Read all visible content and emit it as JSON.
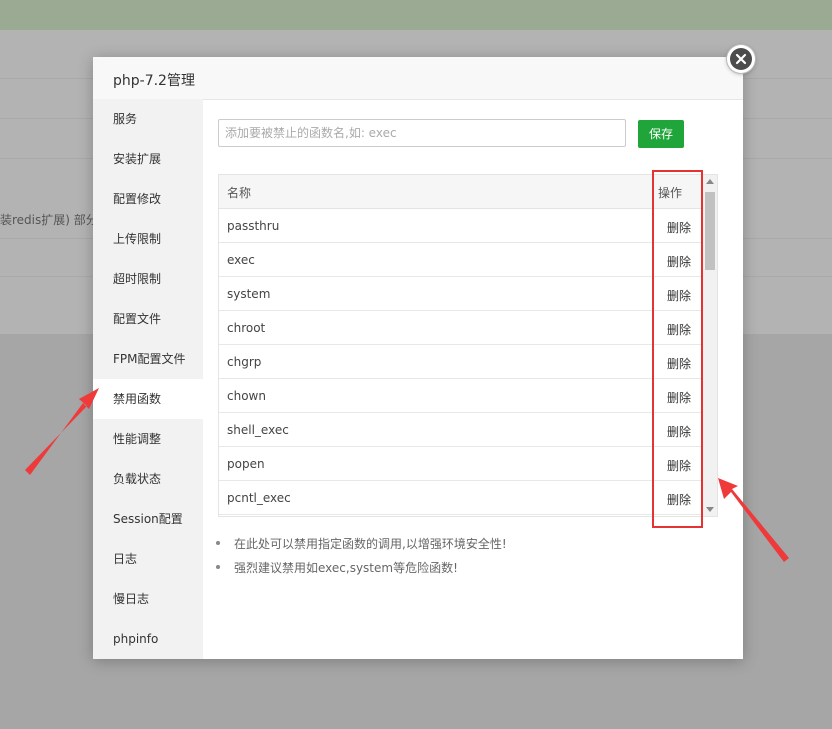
{
  "background": {
    "snippet": "装redis扩展) 部分u"
  },
  "modal": {
    "title": "php-7.2管理"
  },
  "sidebar": {
    "items": [
      {
        "label": "服务"
      },
      {
        "label": "安装扩展"
      },
      {
        "label": "配置修改"
      },
      {
        "label": "上传限制"
      },
      {
        "label": "超时限制"
      },
      {
        "label": "配置文件"
      },
      {
        "label": "FPM配置文件"
      },
      {
        "label": "禁用函数"
      },
      {
        "label": "性能调整"
      },
      {
        "label": "负载状态"
      },
      {
        "label": "Session配置"
      },
      {
        "label": "日志"
      },
      {
        "label": "慢日志"
      },
      {
        "label": "phpinfo"
      }
    ],
    "active": "禁用函数"
  },
  "form": {
    "placeholder": "添加要被禁止的函数名,如: exec",
    "value": "",
    "save_label": "保存"
  },
  "table": {
    "columns": [
      "名称",
      "操作"
    ],
    "rows": [
      {
        "name": "passthru",
        "action": "删除"
      },
      {
        "name": "exec",
        "action": "删除"
      },
      {
        "name": "system",
        "action": "删除"
      },
      {
        "name": "chroot",
        "action": "删除"
      },
      {
        "name": "chgrp",
        "action": "删除"
      },
      {
        "name": "chown",
        "action": "删除"
      },
      {
        "name": "shell_exec",
        "action": "删除"
      },
      {
        "name": "popen",
        "action": "删除"
      },
      {
        "name": "pcntl_exec",
        "action": "删除"
      }
    ]
  },
  "tips": [
    "在此处可以禁用指定函数的调用,以增强环境安全性!",
    "强烈建议禁用如exec,system等危险函数!"
  ],
  "colors": {
    "accent": "#20a53a",
    "annotation": "#e53333"
  },
  "icons": {
    "close": "close-icon",
    "scroll_up": "caret-up-icon",
    "scroll_down": "caret-down-icon"
  }
}
